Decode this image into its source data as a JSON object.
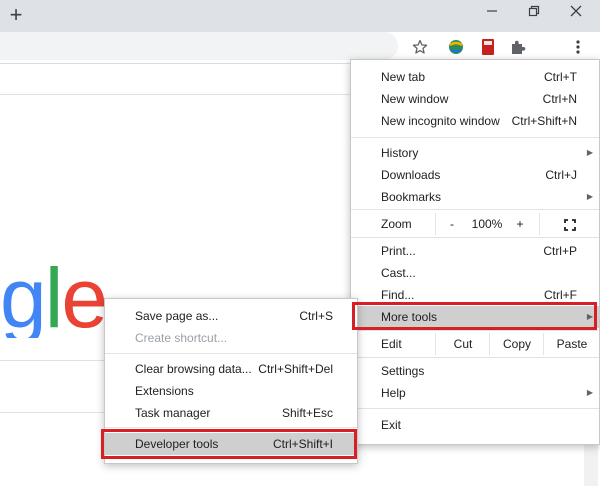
{
  "titlebar": {
    "new_tab_icon": "plus-icon",
    "minimize_icon": "minimize-icon",
    "restore_icon": "restore-icon",
    "close_icon": "close-icon"
  },
  "toolbar": {
    "icons": [
      "star-icon",
      "extension-globe-icon",
      "extension-book-icon",
      "puzzle-icon",
      "kebab-menu-icon"
    ]
  },
  "page": {
    "logo_letters": [
      {
        "ch": "g",
        "color": "#4285F4"
      },
      {
        "ch": "l",
        "color": "#34A853"
      },
      {
        "ch": "e",
        "color": "#EA4335"
      }
    ]
  },
  "menu": {
    "new_tab": "New tab",
    "new_tab_sc": "Ctrl+T",
    "new_window": "New window",
    "new_window_sc": "Ctrl+N",
    "new_incognito": "New incognito window",
    "new_incognito_sc": "Ctrl+Shift+N",
    "history": "History",
    "downloads": "Downloads",
    "downloads_sc": "Ctrl+J",
    "bookmarks": "Bookmarks",
    "zoom": "Zoom",
    "zoom_minus": "-",
    "zoom_value": "100%",
    "zoom_plus": "+",
    "print": "Print...",
    "print_sc": "Ctrl+P",
    "cast": "Cast...",
    "find": "Find...",
    "find_sc": "Ctrl+F",
    "more_tools": "More tools",
    "edit": "Edit",
    "cut": "Cut",
    "copy": "Copy",
    "paste": "Paste",
    "settings": "Settings",
    "help": "Help",
    "exit": "Exit"
  },
  "submenu": {
    "save_page": "Save page as...",
    "save_page_sc": "Ctrl+S",
    "create_shortcut": "Create shortcut...",
    "clear_data": "Clear browsing data...",
    "clear_data_sc": "Ctrl+Shift+Del",
    "extensions": "Extensions",
    "task_manager": "Task manager",
    "task_manager_sc": "Shift+Esc",
    "dev_tools": "Developer tools",
    "dev_tools_sc": "Ctrl+Shift+I"
  },
  "colors": {
    "highlight_box": "#d81f26",
    "hover_row": "#cfcfcf"
  }
}
